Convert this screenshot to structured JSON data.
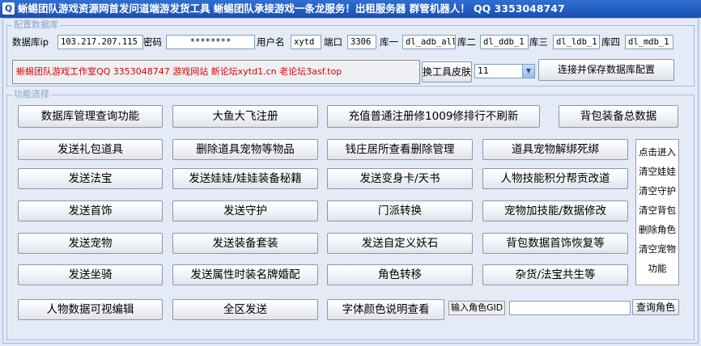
{
  "window": {
    "title": "蜥蜴团队游戏资源网首发问道端游发货工具 蜥蜴团队承接游戏一条龙服务！出租服务器 群管机器人！ QQ 3353048747"
  },
  "config": {
    "group_title": "配置数据库",
    "db_ip_label": "数据库ip",
    "db_ip": "103.217.207.115",
    "password_label": "密码",
    "password": "********",
    "username_label": "用户名",
    "username": "xytd",
    "port_label": "端口",
    "port": "3306",
    "db1_label": "库一",
    "db1": "dl_adb_all",
    "db2_label": "库二",
    "db2": "dl_ddb_1",
    "db3_label": "库三",
    "db3": "dl_ldb_1",
    "db4_label": "库四",
    "db4": "dl_mdb_1",
    "notice": "蜥蜴团队游戏工作室QQ 3353048747  游戏网站 新论坛xytd1.cn 老论坛3asf.top",
    "skin_button": "换工具皮肤",
    "skin_value": "11",
    "connect_button": "连接并保存数据库配置"
  },
  "functions": {
    "group_title": "功能选择",
    "buttons": [
      "数据库管理查询功能",
      "大鱼大飞注册",
      "充值普通注册修1009修排行不刷新",
      "背包装备总数据",
      "发送礼包道具",
      "删除道具宠物等物品",
      "钱庄居所查看删除管理",
      "道具宠物解绑死绑",
      "发送法宝",
      "发送娃娃/娃娃装备秘籍",
      "发送变身卡/天书",
      "人物技能积分帮贡改道",
      "发送首饰",
      "发送守护",
      "门派转换",
      "宠物加技能/数据修改",
      "发送宠物",
      "发送装备套装",
      "发送自定义妖石",
      "背包数据首饰恢复等",
      "发送坐骑",
      "发送属性时装名牌婚配",
      "角色转移",
      "杂货/法宝共生等",
      "人物数据可视编辑",
      "全区发送",
      "字体颜色说明查看"
    ],
    "side_items": [
      "点击进入",
      "清空娃娃",
      "清空守护",
      "清空背包",
      "删除角色",
      "清空宠物",
      "功能"
    ],
    "gid_label": "输入角色GID",
    "gid_value": "",
    "query_role_button": "查询角色"
  }
}
